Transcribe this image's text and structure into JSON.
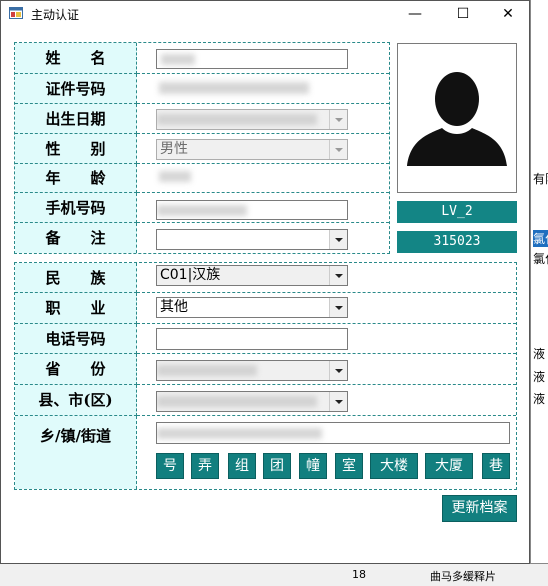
{
  "window": {
    "title": "主动认证",
    "minimize_glyph": "—",
    "maximize_glyph": "☐",
    "close_glyph": "✕"
  },
  "personal": {
    "labels": {
      "name": "姓　　名",
      "id_number": "证件号码",
      "birth_date": "出生日期",
      "gender": "性　　别",
      "age": "年　　龄",
      "mobile": "手机号码",
      "remark": "备　　注"
    },
    "gender_value": "男性",
    "remark_value": ""
  },
  "badges": {
    "level": "LV_2",
    "code": "315023"
  },
  "address": {
    "labels": {
      "ethnicity": "民　　族",
      "occupation": "职　　业",
      "phone": "电话号码",
      "province": "省　　份",
      "county": "县、市(区)",
      "street": "乡/镇/街道"
    },
    "ethnicity_value": "C01|汉族",
    "occupation_value": "其他",
    "phone_value": "",
    "street_buttons": [
      "号",
      "弄",
      "组",
      "团",
      "幢",
      "室",
      "大楼",
      "大厦",
      "巷"
    ]
  },
  "update_button": "更新档案",
  "background": {
    "right_fragments": [
      "有限",
      "氯化",
      "氯化",
      "液",
      "液",
      "液"
    ],
    "bottom_cells": [
      "18",
      "曲马多缓释片"
    ]
  },
  "icons": {
    "app": "app-window-icon",
    "photo": "person-silhouette-icon",
    "dropdown": "chevron-down-icon"
  },
  "colors": {
    "teal": "#127f7f",
    "label_bg": "#e0fbfb",
    "border": "#2a8a8a"
  }
}
